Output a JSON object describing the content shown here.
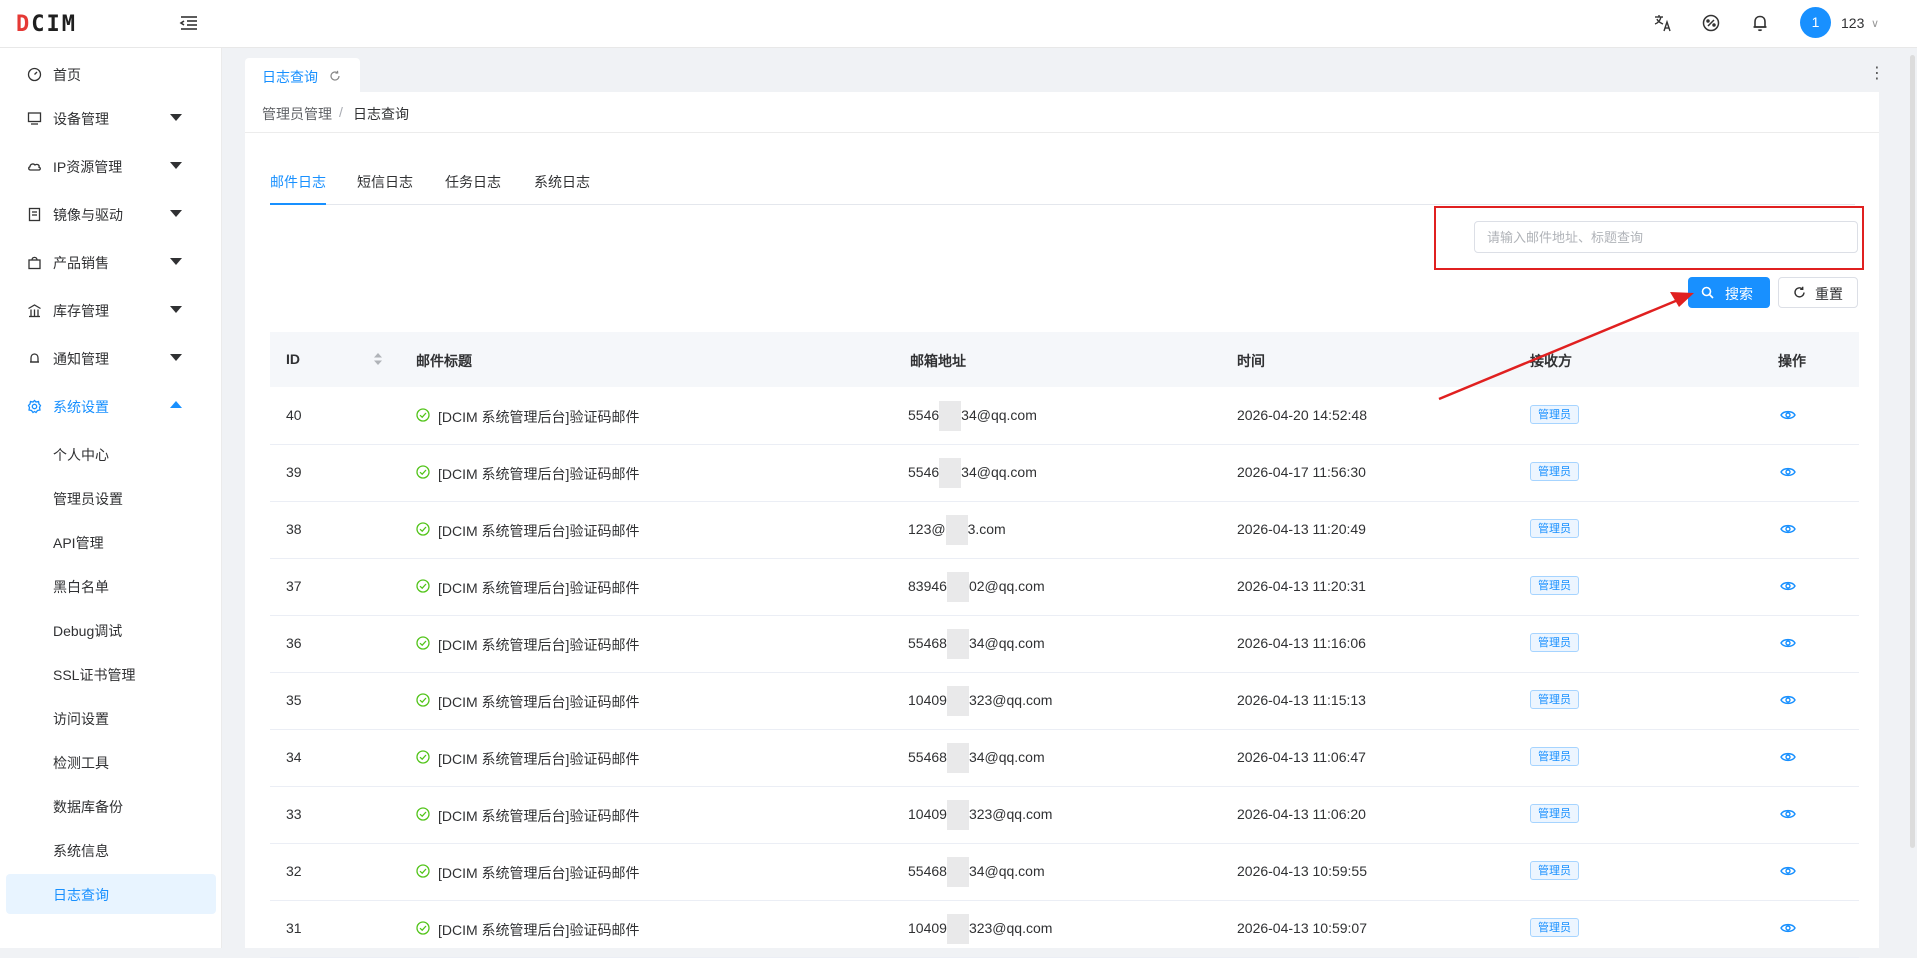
{
  "app": {
    "logo_left": "D",
    "logo_rest": "CIM"
  },
  "header": {
    "avatar_initial": "1",
    "username": "123"
  },
  "sidebar": {
    "items": [
      {
        "label": "首页"
      },
      {
        "label": "设备管理"
      },
      {
        "label": "IP资源管理"
      },
      {
        "label": "镜像与驱动"
      },
      {
        "label": "产品销售"
      },
      {
        "label": "库存管理"
      },
      {
        "label": "通知管理"
      },
      {
        "label": "系统设置"
      }
    ],
    "sub_items": [
      {
        "label": "个人中心"
      },
      {
        "label": "管理员设置"
      },
      {
        "label": "API管理"
      },
      {
        "label": "黑白名单"
      },
      {
        "label": "Debug调试"
      },
      {
        "label": "SSL证书管理"
      },
      {
        "label": "访问设置"
      },
      {
        "label": "检测工具"
      },
      {
        "label": "数据库备份"
      },
      {
        "label": "系统信息"
      },
      {
        "label": "日志查询"
      }
    ]
  },
  "page_tab": {
    "label": "日志查询"
  },
  "breadcrumb": {
    "parent": "管理员管理",
    "separator": "/",
    "current": "日志查询"
  },
  "log_tabs": [
    "邮件日志",
    "短信日志",
    "任务日志",
    "系统日志"
  ],
  "search": {
    "placeholder": "请输入邮件地址、标题查询",
    "value": ""
  },
  "buttons": {
    "search": "搜索",
    "reset": "重置"
  },
  "table": {
    "headers": [
      "ID",
      "邮件标题",
      "邮箱地址",
      "时间",
      "接收方",
      "操作"
    ],
    "rows": [
      {
        "id": "40",
        "title": "[DCIM 系统管理后台]验证码邮件",
        "email_a": "5546",
        "email_b": "34@qq.com",
        "time": "2026-04-20 14:52:48",
        "receiver": "管理员"
      },
      {
        "id": "39",
        "title": "[DCIM 系统管理后台]验证码邮件",
        "email_a": "5546",
        "email_b": "34@qq.com",
        "time": "2026-04-17 11:56:30",
        "receiver": "管理员"
      },
      {
        "id": "38",
        "title": "[DCIM 系统管理后台]验证码邮件",
        "email_a": "123@",
        "email_b": "3.com",
        "time": "2026-04-13 11:20:49",
        "receiver": "管理员"
      },
      {
        "id": "37",
        "title": "[DCIM 系统管理后台]验证码邮件",
        "email_a": "83946",
        "email_b": "02@qq.com",
        "time": "2026-04-13 11:20:31",
        "receiver": "管理员"
      },
      {
        "id": "36",
        "title": "[DCIM 系统管理后台]验证码邮件",
        "email_a": "55468",
        "email_b": "34@qq.com",
        "time": "2026-04-13 11:16:06",
        "receiver": "管理员"
      },
      {
        "id": "35",
        "title": "[DCIM 系统管理后台]验证码邮件",
        "email_a": "10409",
        "email_b": "323@qq.com",
        "time": "2026-04-13 11:15:13",
        "receiver": "管理员"
      },
      {
        "id": "34",
        "title": "[DCIM 系统管理后台]验证码邮件",
        "email_a": "55468",
        "email_b": "34@qq.com",
        "time": "2026-04-13 11:06:47",
        "receiver": "管理员"
      },
      {
        "id": "33",
        "title": "[DCIM 系统管理后台]验证码邮件",
        "email_a": "10409",
        "email_b": "323@qq.com",
        "time": "2026-04-13 11:06:20",
        "receiver": "管理员"
      },
      {
        "id": "32",
        "title": "[DCIM 系统管理后台]验证码邮件",
        "email_a": "55468",
        "email_b": "34@qq.com",
        "time": "2026-04-13 10:59:55",
        "receiver": "管理员"
      },
      {
        "id": "31",
        "title": "[DCIM 系统管理后台]验证码邮件",
        "email_a": "10409",
        "email_b": "323@qq.com",
        "time": "2026-04-13 10:59:07",
        "receiver": "管理员"
      }
    ]
  },
  "colors": {
    "accent": "#1890ff",
    "annotation": "#e02020",
    "success": "#52c41a"
  },
  "icons": [
    "translate-icon",
    "theme-icon",
    "bell-icon",
    "dashboard-icon",
    "monitor-icon",
    "cloud-icon",
    "image-icon",
    "shop-icon",
    "warehouse-icon",
    "bell-icon",
    "gear-icon",
    "refresh-icon",
    "search-icon",
    "reset-icon",
    "sort-icon",
    "check-circle-icon",
    "eye-icon"
  ]
}
